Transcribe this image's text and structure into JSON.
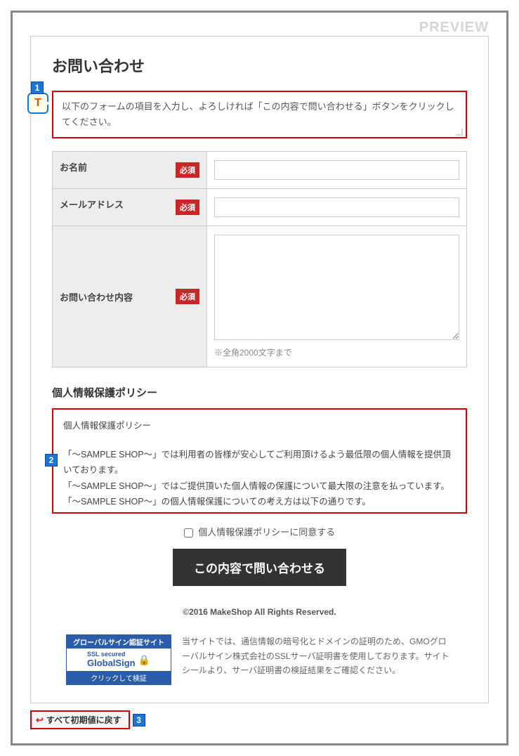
{
  "preview_label": "PREVIEW",
  "page": {
    "title": "お問い合わせ",
    "intro": "以下のフォームの項目を入力し、よろしければ「この内容で問い合わせる」ボタンをクリックしてください。"
  },
  "callouts": {
    "one": "1",
    "two": "2",
    "three": "3",
    "t": "T"
  },
  "form": {
    "required_label": "必須",
    "fields": {
      "name": {
        "label": "お名前",
        "value": ""
      },
      "email": {
        "label": "メールアドレス",
        "value": ""
      },
      "body": {
        "label": "お問い合わせ内容",
        "value": "",
        "char_limit_note": "※全角2000文字まで"
      }
    }
  },
  "policy": {
    "title": "個人情報保護ポリシー",
    "heading": "個人情報保護ポリシー",
    "line1": "「～SAMPLE SHOP～」では利用者の皆様が安心してご利用頂けるよう最低限の個人情報を提供頂いております。",
    "line2": "「～SAMPLE SHOP～」ではご提供頂いた個人情報の保護について最大限の注意を払っています。",
    "line3": "「～SAMPLE SHOP～」の個人情報保護についての考え方は以下の通りです。",
    "agree_label": "個人情報保護ポリシーに同意する"
  },
  "submit_label": "この内容で問い合わせる",
  "copyright": "©2016 MakeShop All Rights Reserved.",
  "ssl": {
    "seal_top": "グローバルサイン認証サイト",
    "seal_mid1": "SSL secured",
    "seal_mid2": "GlobalSign",
    "seal_bot": "クリックして検証",
    "desc": "当サイトでは、通信情報の暗号化とドメインの証明のため、GMOグローバルサイン株式会社のSSLサーバ証明書を使用しております。サイトシールより、サーバ証明書の検証結果をご確認ください。"
  },
  "reset_label": "すべて初期値に戻す"
}
